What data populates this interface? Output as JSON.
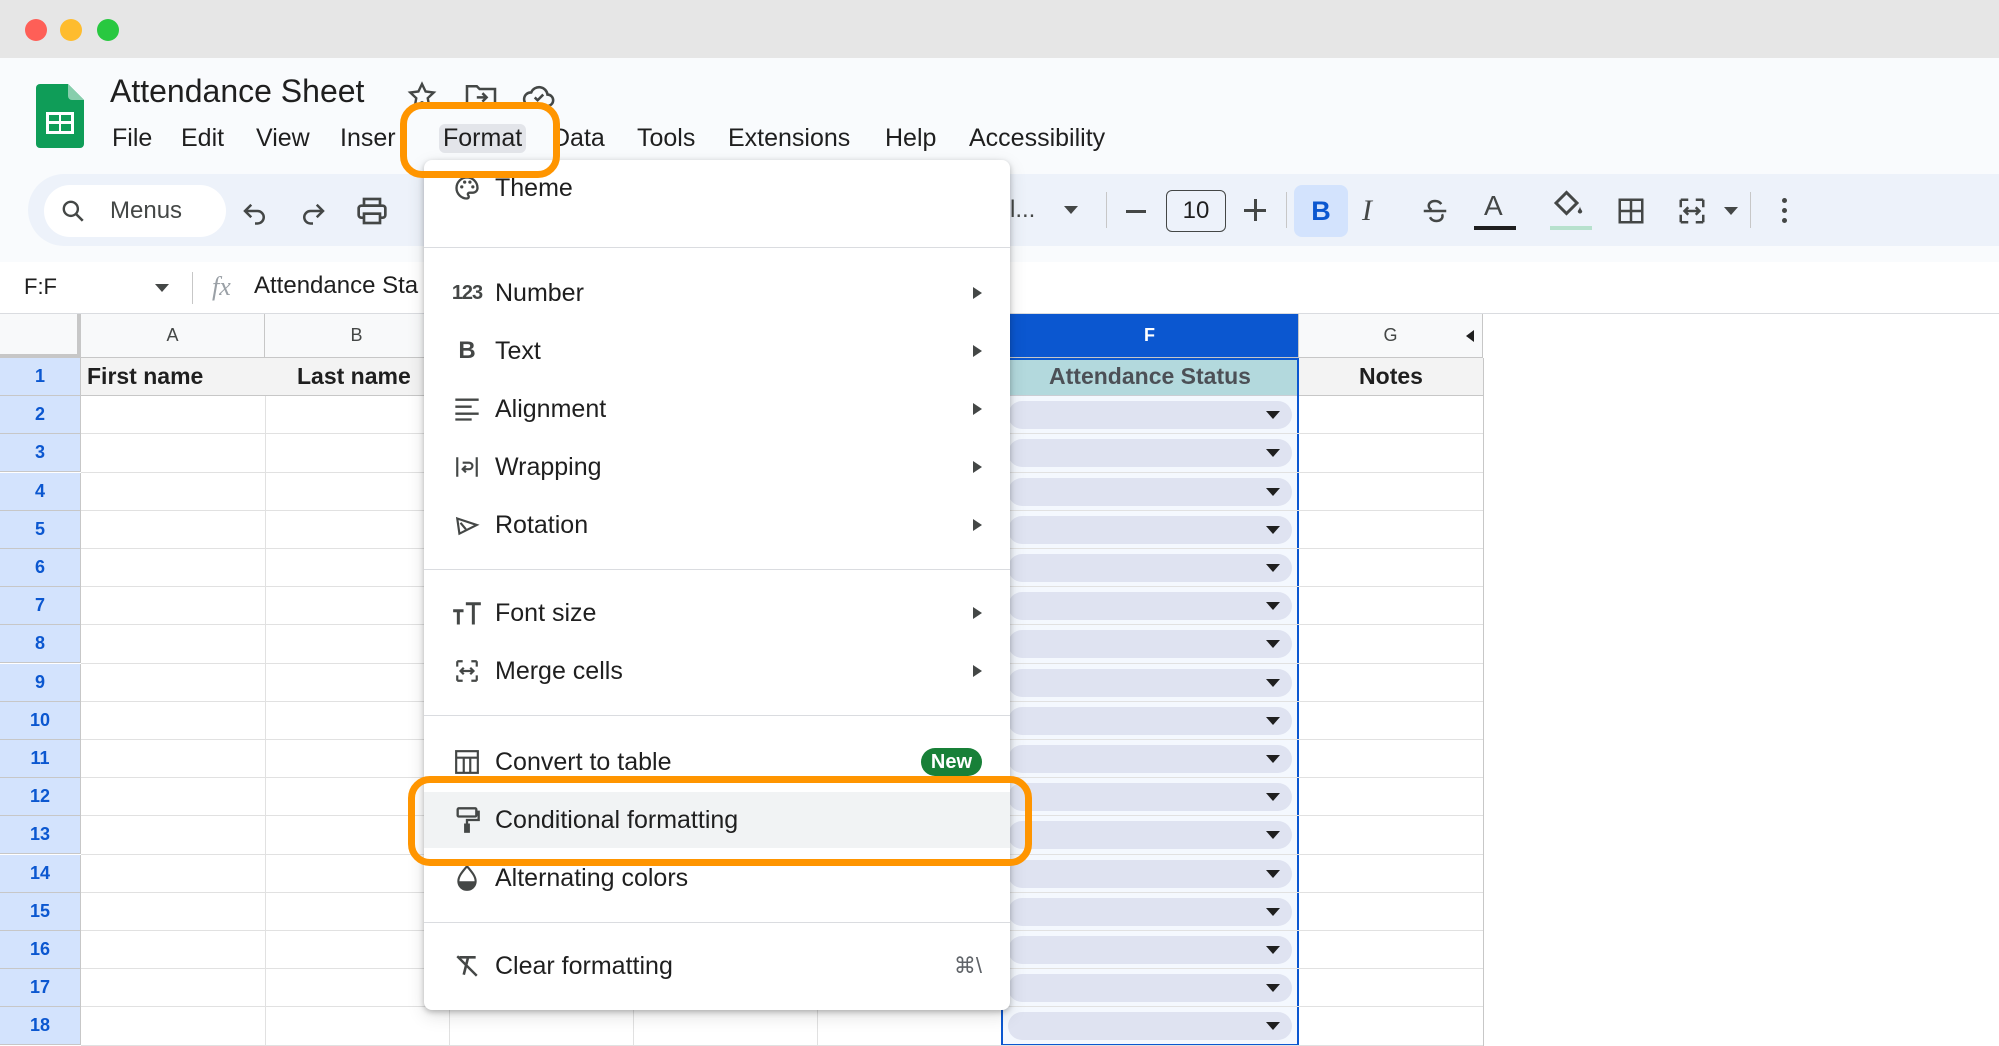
{
  "window": {
    "title": "Attendance Sheet"
  },
  "menubar": [
    "File",
    "Edit",
    "View",
    "Inser",
    "Format",
    "Data",
    "Tools",
    "Extensions",
    "Help",
    "Accessibility"
  ],
  "toolbar": {
    "search_label": "Menus",
    "font_truncated": "l...",
    "font_size": "10",
    "icons": [
      "undo-icon",
      "redo-icon",
      "print-icon",
      "decrease-font-icon",
      "increase-font-icon",
      "bold-icon",
      "italic-icon",
      "strikethrough-icon",
      "text-color-icon",
      "fill-color-icon",
      "borders-icon",
      "merge-cells-icon",
      "more-icon"
    ]
  },
  "formula_bar": {
    "name_box": "F:F",
    "fx": "fx",
    "content": "Attendance Sta"
  },
  "grid": {
    "columns": [
      {
        "id": "A",
        "label": "A"
      },
      {
        "id": "B",
        "label": "B"
      },
      {
        "id": "F",
        "label": "F"
      },
      {
        "id": "G",
        "label": "G"
      }
    ],
    "header_row": {
      "A": "First name",
      "B": "Last name",
      "F": "Attendance Status",
      "G": "Notes"
    },
    "row_numbers": [
      "1",
      "2",
      "3",
      "4",
      "5",
      "6",
      "7",
      "8",
      "9",
      "10",
      "11",
      "12",
      "13",
      "14",
      "15",
      "16",
      "17",
      "18"
    ],
    "selected_column": "F",
    "colors": {
      "selected_col": "#0b57d0",
      "header_f_bg": "#a9d6d3",
      "chip_bg": "#dfe3f1",
      "row_head_bg": "#d3e3fd"
    }
  },
  "format_menu": {
    "items": [
      {
        "label": "Theme",
        "icon": "palette-icon",
        "submenu": false
      },
      {
        "label": "Number",
        "icon": "number-format-icon",
        "submenu": true
      },
      {
        "label": "Text",
        "icon": "bold-text-icon",
        "submenu": true
      },
      {
        "label": "Alignment",
        "icon": "align-icon",
        "submenu": true
      },
      {
        "label": "Wrapping",
        "icon": "wrap-icon",
        "submenu": true
      },
      {
        "label": "Rotation",
        "icon": "rotation-icon",
        "submenu": true
      },
      {
        "label": "Font size",
        "icon": "font-size-icon",
        "submenu": true
      },
      {
        "label": "Merge cells",
        "icon": "merge-icon",
        "submenu": true
      },
      {
        "label": "Convert to table",
        "icon": "table-icon",
        "badge": "New"
      },
      {
        "label": "Conditional formatting",
        "icon": "paint-roller-icon",
        "highlighted": true
      },
      {
        "label": "Alternating colors",
        "icon": "alternating-colors-icon"
      },
      {
        "label": "Clear formatting",
        "icon": "clear-formatting-icon",
        "shortcut": "⌘\\"
      }
    ],
    "icon_glyphs": {
      "number": "123",
      "text": "B"
    }
  },
  "annotation": {
    "highlight_color": "#ff9500"
  }
}
